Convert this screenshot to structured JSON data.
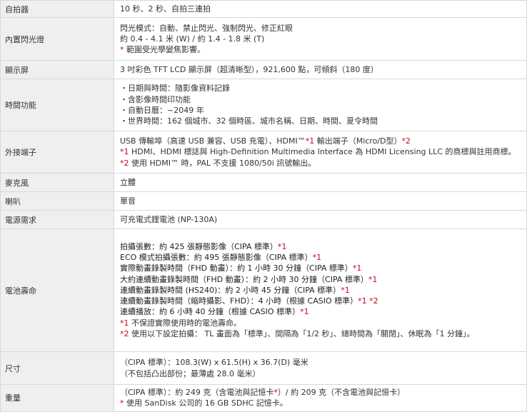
{
  "rows": [
    {
      "label": "自拍器",
      "lines": [
        [
          {
            "t": "10 秒、2 秒、自拍三連拍"
          }
        ]
      ]
    },
    {
      "label": "內置閃光燈",
      "lines": [
        [
          {
            "t": "閃光模式：自動、禁止閃光、強制閃光、修正紅眼"
          }
        ],
        [
          {
            "t": "約 0.4 - 4.1 米 (W) / 約 1.4 - 1.8 米 (T)"
          }
        ],
        [
          {
            "t": "* ",
            "red": true
          },
          {
            "t": "範圍受光學變焦影響。"
          }
        ]
      ]
    },
    {
      "label": "顯示屏",
      "lines": [
        [
          {
            "t": "3 吋彩色 TFT LCD 顯示屏（超清晰型），921,600 點，可傾斜（180 度）"
          }
        ]
      ]
    },
    {
      "label": "時間功能",
      "lines": [
        [
          {
            "t": "・日期與時間：隨影像資料記錄"
          }
        ],
        [
          {
            "t": "・含影像時間印功能"
          }
        ],
        [
          {
            "t": "・自動日曆：~2049 年"
          }
        ],
        [
          {
            "t": "・世界時間：162 個城市、32 個時區、城市名稱、日期、時間、夏令時間"
          }
        ]
      ]
    },
    {
      "label": "外接端子",
      "lines": [
        [
          {
            "t": "USB 傳輸埠（高速 USB 兼容、USB 充電）、HDMI™"
          },
          {
            "t": "*1",
            "red": true
          },
          {
            "t": " 輸出端子（Micro/D型）"
          },
          {
            "t": "*2",
            "red": true
          }
        ],
        [
          {
            "t": "*1",
            "red": true
          },
          {
            "t": " HDMI、HDMI 標誌與 High-Definition Multimedia Interface 為 HDMI Licensing LLC 的商標與註用商標。"
          }
        ],
        [
          {
            "t": "*2",
            "red": true
          },
          {
            "t": " 使用 HDMI™ 時，PAL 不支援 1080/50i 訊號輸出。"
          }
        ]
      ]
    },
    {
      "label": "麥克風",
      "lines": [
        [
          {
            "t": "立體"
          }
        ]
      ]
    },
    {
      "label": "喇叭",
      "lines": [
        [
          {
            "t": "單音"
          }
        ]
      ]
    },
    {
      "label": "電源需求",
      "lines": [
        [
          {
            "t": "可充電式鋰電池 (NP-130A)"
          }
        ]
      ]
    },
    {
      "label": "電池壽命",
      "lines": [
        [
          {
            "t": "拍攝張數：約 425 張靜態影像（CIPA 標準）",
            "dark": true
          },
          {
            "t": "*1",
            "red": true
          }
        ],
        [
          {
            "t": "ECO 模式拍攝張數：約 495 張靜態影像（CIPA 標準）",
            "dark": true
          },
          {
            "t": "*1",
            "red": true
          }
        ],
        [
          {
            "t": "實際動畫錄製時間（FHD 動畫）：約 1 小時 30 分鐘（CIPA 標準）",
            "dark": true
          },
          {
            "t": "*1",
            "red": true
          }
        ],
        [
          {
            "t": "大約連續動畫錄製時間（FHD 動畫）：約 2 小時 30 分鐘（CIPA 標準）",
            "dark": true
          },
          {
            "t": "*1",
            "red": true
          }
        ],
        [
          {
            "t": "連續動畫錄製時間 (HS240)：約 2 小時 45 分鐘（CIPA 標準）",
            "dark": true
          },
          {
            "t": "*1",
            "red": true
          }
        ],
        [
          {
            "t": "連續動畫錄製時間（縮時攝影、FHD）：4 小時（根據 CASIO 標準）",
            "dark": true
          },
          {
            "t": "*1 *2",
            "red": true
          }
        ],
        [
          {
            "t": "連續播放：約 6 小時 40 分鐘（根據 CASIO 標準）",
            "dark": true
          },
          {
            "t": "*1",
            "red": true
          }
        ],
        [
          {
            "t": "*1",
            "red": true
          },
          {
            "t": " 不保證實際使用時的電池壽命。"
          }
        ],
        [
          {
            "t": "*2",
            "red": true
          },
          {
            "t": " 使用以下設定拍攝： TL 畫面為「標準」、間隔為「1/2 秒」、總時間為「關閉」、休眠為「1 分鐘」。"
          }
        ]
      ]
    },
    {
      "label": "尺寸",
      "lines": [
        [
          {
            "t": "（CIPA 標準）：108.3(W) x 61.5(H) x 36.7(D) 毫米"
          }
        ],
        [
          {
            "t": "（不包括凸出部份；最薄處 28.0 毫米）"
          }
        ]
      ]
    },
    {
      "label": "重量",
      "lines": [
        [
          {
            "t": "（CIPA 標準）：約 249 克（含電池與記憶卡"
          },
          {
            "t": "*",
            "red": true
          },
          {
            "t": "）/ 約 209 克（不含電池與記憶卡）"
          }
        ],
        [
          {
            "t": "* ",
            "red": true
          },
          {
            "t": "使用 SanDisk 公司的 16 GB SDHC 記憶卡。"
          }
        ]
      ]
    }
  ]
}
